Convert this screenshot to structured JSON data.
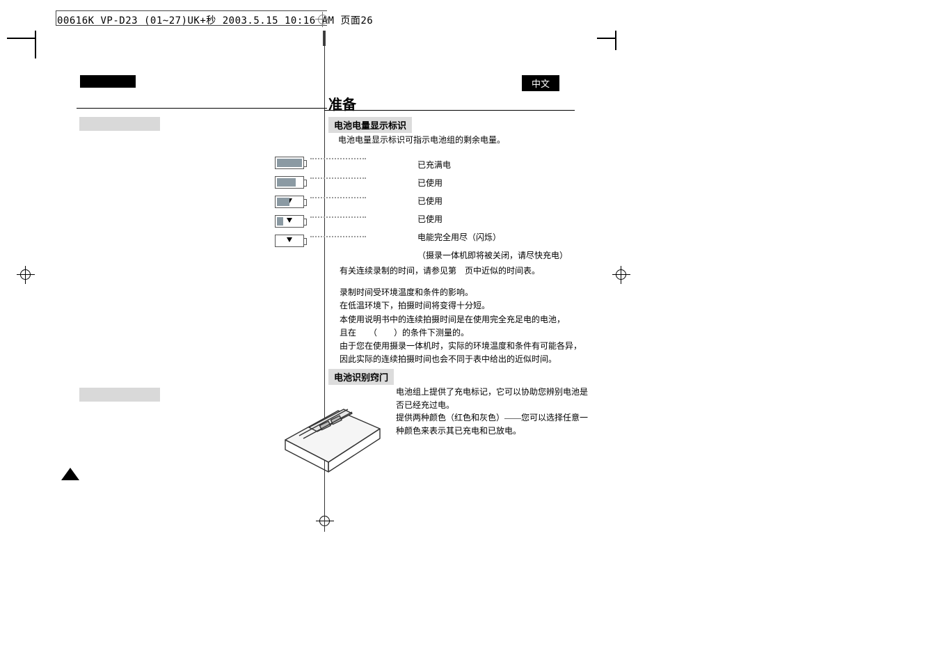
{
  "header_strip": "00616K VP-D23 (01~27)UK+秒  2003.5.15 10:16 AM  页面26",
  "lang_tab": "中文",
  "section_title_right": "准备",
  "sub_heading_1": "电池电量显示标识",
  "sub_intro": "电池电量显示标识可指示电池组的剩余电量。",
  "levels": {
    "l1": "已充满电",
    "l2": "已使用",
    "l3": "已使用",
    "l4": "已使用",
    "l5a": "电能完全用尽（闪烁）",
    "l5b": "（摄录一体机即将被关闭，请尽快充电）"
  },
  "notes": {
    "n1": "有关连续录制的时间，请参见第　页中近似的时间表。",
    "n2": "录制时间受环境温度和条件的影响。",
    "n3": "在低温环境下，拍摄时间将变得十分短。",
    "n4": "本使用说明书中的连续拍摄时间是在使用完全充足电的电池，",
    "n5": "且在　　（　　）的条件下测量的。",
    "n6": "由于您在使用摄录一体机时，实际的环境温度和条件有可能各异，",
    "n7": "因此实际的连续拍摄时间也会不同于表中给出的近似时间。"
  },
  "sub_heading_2": "电池识别窍门",
  "tip": {
    "t1": "电池组上提供了充电标记，它可以协助您辨别电池是否已经充过电。",
    "t2": "提供两种颜色（红色和灰色）——您可以选择任意一种颜色来表示其已充电和已放电。"
  }
}
